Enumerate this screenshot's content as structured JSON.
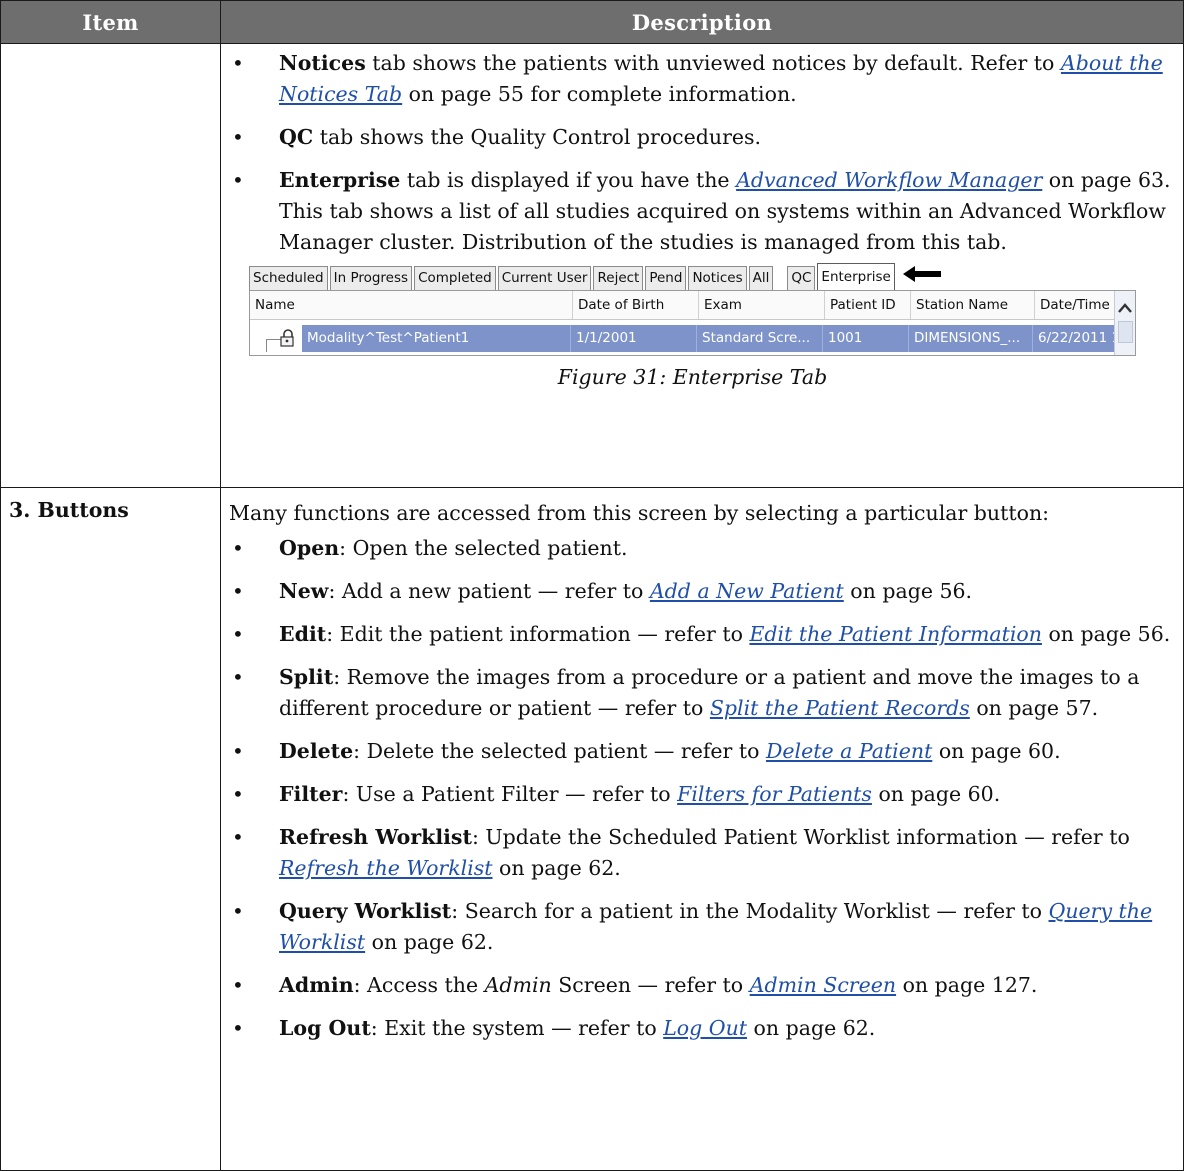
{
  "table": {
    "header": {
      "item": "Item",
      "description": "Description"
    }
  },
  "row1": {
    "item": "",
    "bullets": [
      {
        "bold": "Notices",
        "pre": " tab shows the patients with unviewed notices by default. Refer to ",
        "link": "About the Notices Tab",
        "post": " on page 55 for complete information."
      },
      {
        "bold": "QC",
        "pre": " tab shows the Quality Control procedures.",
        "link": "",
        "post": ""
      },
      {
        "bold": "Enterprise",
        "pre": " tab is displayed if you have the ",
        "link": "Advanced Workflow Manager",
        "post": " on page 63. This tab shows a list of all studies acquired on systems within an Advanced Workflow Manager cluster. Distribution of the studies is managed from this tab."
      }
    ],
    "figure": {
      "tabs": [
        "Scheduled",
        "In Progress",
        "Completed",
        "Current User",
        "Reject",
        "Pend",
        "Notices",
        "All",
        "QC",
        "Enterprise"
      ],
      "columns": [
        "Name",
        "Date of Birth",
        "Exam",
        "Patient ID",
        "Station Name",
        "Date/Time"
      ],
      "row": [
        "Modality^Test^Patient1",
        "1/1/2001",
        "Standard Scre...",
        "1001",
        "DIMENSIONS_...",
        "6/22/2011 1"
      ],
      "caption": "Figure 31: Enterprise Tab",
      "icons": {
        "arrow": "left-arrow-icon",
        "lock": "lock-icon",
        "scroll_up": "chevron-up-icon"
      }
    }
  },
  "row2": {
    "item": "3. Buttons",
    "intro": "Many functions are accessed from this screen by selecting a particular button:",
    "bullets": [
      {
        "bold": "Open",
        "pre": ": Open the selected patient.",
        "link": "",
        "post": ""
      },
      {
        "bold": "New",
        "pre": ": Add a new patient — refer to ",
        "link": "Add a New Patient",
        "post": " on page 56."
      },
      {
        "bold": "Edit",
        "pre": ": Edit the patient information — refer to ",
        "link": "Edit the Patient Information",
        "post": " on page 56."
      },
      {
        "bold": "Split",
        "pre": ": Remove the images from a procedure or a patient and move the images to a different procedure or patient — refer to ",
        "link": "Split the Patient Records",
        "post": " on page 57."
      },
      {
        "bold": "Delete",
        "pre": ": Delete the selected patient — refer to ",
        "link": "Delete a Patient",
        "post": " on page 60."
      },
      {
        "bold": "Filter",
        "pre": ": Use a Patient Filter — refer to ",
        "link": "Filters for Patients",
        "post": " on page 60."
      },
      {
        "bold": "Refresh Worklist",
        "pre": ": Update the Scheduled Patient Worklist information — refer to ",
        "link": "Refresh the Worklist",
        "post": " on page 62."
      },
      {
        "bold": "Query Worklist",
        "pre": ": Search for a patient in the Modality Worklist — refer to ",
        "link": "Query the Worklist",
        "post": " on page 62."
      },
      {
        "bold": "Admin",
        "pre": ": Access the ",
        "em": "Admin",
        "pre2": " Screen — refer to ",
        "link": "Admin Screen",
        "post": " on page 127."
      },
      {
        "bold": "Log Out",
        "pre": ": Exit the system — refer to ",
        "link": "Log Out",
        "post": " on page 62."
      }
    ]
  },
  "colors": {
    "header_bg": "#6e6e6e",
    "link": "#1f4fa8",
    "selection": "#7d93c9"
  }
}
